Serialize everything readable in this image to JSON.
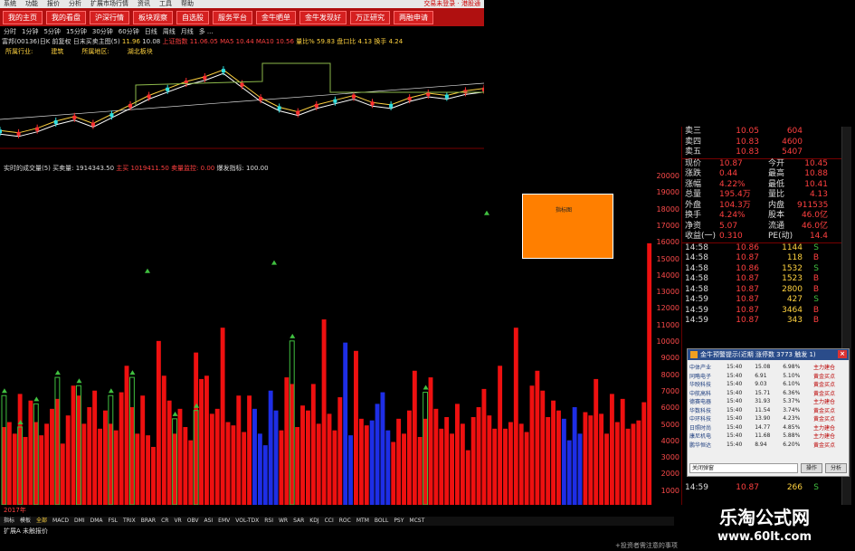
{
  "menu": {
    "items": [
      "系统",
      "功能",
      "报价",
      "分析",
      "扩展市场行情",
      "资讯",
      "工具",
      "帮助"
    ],
    "right": "交易未登录 · 港股通"
  },
  "nav": [
    "我的主页",
    "我的看盘",
    "沪深行情",
    "板块观察",
    "自选股",
    "服务平台",
    "金牛晒单",
    "金牛发现好",
    "万正研究",
    "两融申请"
  ],
  "periods": [
    "分时",
    "1分钟",
    "5分钟",
    "15分钟",
    "30分钟",
    "60分钟",
    "日线",
    "周线",
    "月线",
    "多 ..."
  ],
  "info": {
    "title": "富邦(00136)日K 前复权 日末买卖主图(5)",
    "ma5": "11.96",
    "c1": "10.08",
    "label2": "上证指数",
    "ma10": "11.06.05",
    "ma20": "MA5 10.44",
    "ma60": "MA10 10.56",
    "right1": "量比% 59.83",
    "right2": "盘口比 4.13",
    "right3": "换手 4.24"
  },
  "industry": [
    "所属行业:",
    "建筑",
    "所属地区:",
    "湖北板块"
  ],
  "price_chart": {
    "labels": [
      "自杀线1",
      "自杀线1",
      "抄底",
      "变盘",
      "自杀线1"
    ],
    "close_seed": [
      9.8,
      9.7,
      9.9,
      10.2,
      10.4,
      10.1,
      10.5,
      10.9,
      11.3,
      11.6,
      11.9,
      12.1,
      12.4,
      11.8,
      11.2,
      10.8,
      10.6,
      10.9,
      11.1,
      11.3,
      11.0,
      10.9,
      11.2,
      11.4,
      11.3,
      11.5,
      11.6
    ]
  },
  "volume": {
    "header": "实时的成交量(5) 买卖量: 1914343.50",
    "h_red": "主买 1019411.50",
    "h2": "卖量监控: 0.00",
    "h3": "爆发指标: 100.00",
    "axis": [
      "20000",
      "19000",
      "18000",
      "17000",
      "16000",
      "15000",
      "14000",
      "13000",
      "12000",
      "11000",
      "10000",
      "9000",
      "8000",
      "7000",
      "6000",
      "5000",
      "4000",
      "3000",
      "2000",
      "1000"
    ],
    "bars": [
      4700,
      5000,
      4300,
      6700,
      4100,
      6300,
      5000,
      4200,
      4900,
      5800,
      6400,
      3700,
      5400,
      7200,
      6600,
      4900,
      5900,
      6900,
      4600,
      5700,
      4900,
      4500,
      6800,
      8400,
      5900,
      4300,
      6600,
      4200,
      3500,
      9900,
      7800,
      6300,
      4300,
      5800,
      4700,
      3900,
      9200,
      7600,
      7800,
      5500,
      5800,
      10700,
      5000,
      4800,
      6600,
      4400,
      6600,
      5800,
      4300,
      3600,
      6900,
      5700,
      4500,
      7700,
      7300,
      4700,
      6000,
      5700,
      7300,
      4900,
      11200,
      5500,
      4500,
      6500,
      9800,
      4200,
      9300,
      5200,
      4800,
      5100,
      6100,
      6800,
      4500,
      3800,
      5200,
      4300,
      5700,
      8100,
      4100,
      5200,
      7700,
      5800,
      4600,
      5300,
      4300,
      6100,
      4900,
      3300,
      5300,
      5900,
      7000,
      5400,
      4600,
      8400,
      4600,
      5000,
      10700,
      4900,
      4400,
      7200,
      8100,
      6900,
      5300,
      6300,
      5700,
      5200,
      3900,
      5900,
      4300,
      5600,
      5400,
      7600,
      5500,
      4300,
      6700,
      5000,
      6400,
      4600,
      4900,
      5100,
      6200,
      15800
    ],
    "green_lines": [
      6600,
      0,
      0,
      4700,
      0,
      0,
      6100,
      0,
      0,
      0,
      7700,
      0,
      0,
      0,
      7200,
      0,
      0,
      0,
      0,
      0,
      6600,
      0,
      0,
      0,
      7700,
      0,
      0,
      0,
      0,
      0,
      0,
      0,
      5200,
      0,
      0,
      0,
      5700,
      0,
      0,
      0,
      0,
      0,
      0,
      0,
      0,
      0,
      0,
      0,
      0,
      0,
      0,
      0,
      0,
      0,
      9900,
      0,
      0,
      0,
      0,
      0,
      0,
      0,
      0,
      0,
      0,
      0,
      0,
      0,
      0,
      0,
      0,
      0,
      0,
      0,
      0,
      0,
      0,
      0,
      0,
      6800,
      0,
      0,
      0,
      0,
      0,
      0,
      0,
      0,
      0,
      0,
      0,
      0,
      0,
      0,
      0,
      0,
      0,
      0,
      0,
      0,
      0,
      0,
      0,
      0,
      0,
      0,
      0,
      0,
      0,
      0,
      0,
      0,
      0,
      0,
      0,
      0,
      0,
      0,
      0,
      0,
      0,
      0,
      0,
      0
    ],
    "blue_index": [
      47,
      48,
      49,
      50,
      51,
      64,
      65,
      69,
      70,
      71,
      72,
      105,
      106,
      107,
      108
    ]
  },
  "date_label": "2017年",
  "indicators": [
    "指标",
    "模板",
    "全部",
    "MACD",
    "DMI",
    "DMA",
    "FSL",
    "TRIX",
    "BRAR",
    "CR",
    "VR",
    "OBV",
    "ASI",
    "EMV",
    "VOL-TDX",
    "RSI",
    "WR",
    "SAR",
    "KDJ",
    "CCI",
    "ROC",
    "MTM",
    "BOLL",
    "PSY",
    "MCST"
  ],
  "bottom": "扩展A 未触报价",
  "quote": {
    "book": [
      [
        "卖三",
        "10.05",
        "604"
      ],
      [
        "卖四",
        "10.83",
        "4600"
      ],
      [
        "卖五",
        "10.83",
        "5407"
      ]
    ],
    "stats": [
      [
        "现价",
        "10.87",
        "今开",
        "10.45"
      ],
      [
        "涨跌",
        "0.44",
        "最高",
        "10.88"
      ],
      [
        "涨幅",
        "4.22%",
        "最低",
        "10.41"
      ],
      [
        "总量",
        "195.4万",
        "量比",
        "4.13"
      ],
      [
        "外盘",
        "104.3万",
        "内盘",
        "911535"
      ],
      [
        "换手",
        "4.24%",
        "股本",
        "46.0亿"
      ],
      [
        "净资",
        "5.07",
        "流通",
        "46.0亿"
      ],
      [
        "收益(一)",
        "0.310",
        "PE(动)",
        "14.4"
      ]
    ],
    "ticks": [
      [
        "14:58",
        "10.86",
        "1144",
        "S"
      ],
      [
        "14:58",
        "10.87",
        "118",
        "B"
      ],
      [
        "14:58",
        "10.86",
        "1532",
        "S"
      ],
      [
        "14:58",
        "10.87",
        "1523",
        "B"
      ],
      [
        "14:58",
        "10.87",
        "2800",
        "B"
      ],
      [
        "14:59",
        "10.87",
        "427",
        "S"
      ],
      [
        "14:59",
        "10.87",
        "3464",
        "B"
      ],
      [
        "14:59",
        "10.87",
        "343",
        "B"
      ]
    ],
    "last": [
      "14:59",
      "10.87",
      "266",
      "S"
    ]
  },
  "orange_label": "指标图",
  "popup": {
    "title": "金牛预警提示(近期 涨停数 3773 触发 1)",
    "rows": [
      [
        "中体产业",
        "15:40",
        "15.08",
        "6.98%",
        "主力建仓"
      ],
      [
        "同略电子",
        "15:40",
        "6.91",
        "5.10%",
        "黄金买点"
      ],
      [
        "华映科技",
        "15:40",
        "9.03",
        "6.10%",
        "黄金买点"
      ],
      [
        "中航高科",
        "15:40",
        "15.71",
        "6.36%",
        "黄金买点"
      ],
      [
        "德赛电器",
        "15:40",
        "31.93",
        "5.37%",
        "主力建仓"
      ],
      [
        "华数科技",
        "15:40",
        "11.54",
        "3.74%",
        "黄金买点"
      ],
      [
        "中环科技",
        "15:40",
        "13.90",
        "4.23%",
        "黄金买点"
      ],
      [
        "日照时尚",
        "15:40",
        "14.77",
        "4.85%",
        "主力建仓"
      ],
      [
        "康尼机电",
        "15:40",
        "11.68",
        "5.88%",
        "主力建仓"
      ],
      [
        "鹏华恒达",
        "15:40",
        "8.94",
        "6.20%",
        "黄金买点"
      ]
    ],
    "input": "关闭弹窗",
    "btn1": "操作",
    "btn2": "分析"
  },
  "watermark": {
    "t1": "乐淘公式网",
    "t2": "www.60lt.com"
  },
  "footnote": "+投资者需注意的事项"
}
